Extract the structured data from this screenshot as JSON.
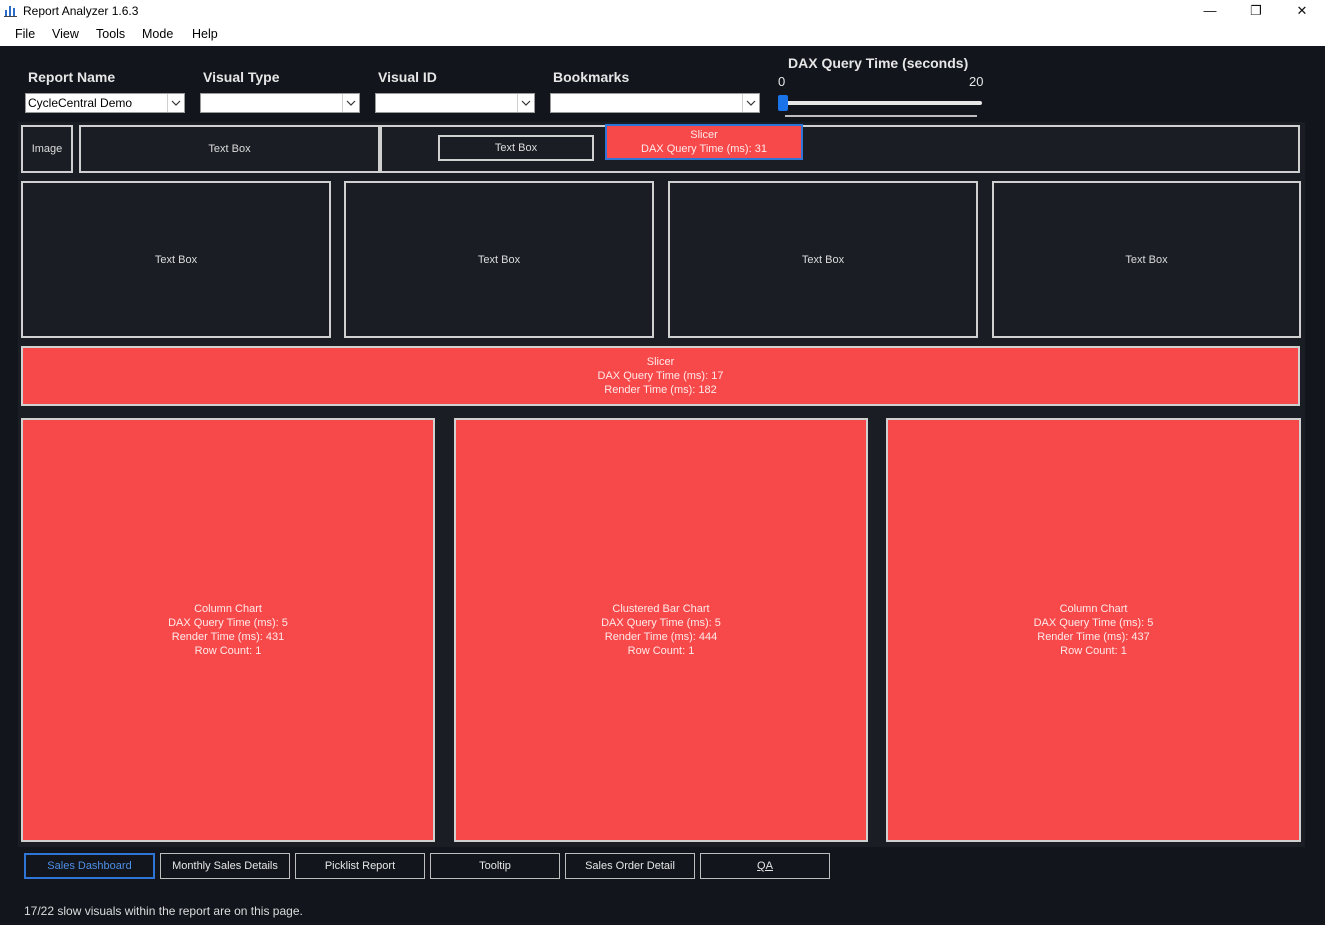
{
  "window": {
    "title": "Report Analyzer 1.6.3",
    "minimize_glyph": "—",
    "maximize_glyph": "❐",
    "close_glyph": "✕"
  },
  "menu": {
    "items": [
      "File",
      "View",
      "Tools",
      "Mode",
      "Help"
    ]
  },
  "filters": {
    "report_name": {
      "label": "Report Name",
      "value": "CycleCentral Demo"
    },
    "visual_type": {
      "label": "Visual Type",
      "value": ""
    },
    "visual_id": {
      "label": "Visual ID",
      "value": ""
    },
    "bookmarks": {
      "label": "Bookmarks",
      "value": ""
    }
  },
  "dax_slider": {
    "label": "DAX Query Time (seconds)",
    "min": "0",
    "max": "20",
    "value": 0
  },
  "visuals": {
    "image": {
      "type": "Image"
    },
    "textbox_top_1": {
      "type": "Text Box"
    },
    "textbox_top_2": {
      "type": "Text Box"
    },
    "slicer_top": {
      "type": "Slicer",
      "dax": "DAX Query Time (ms): 31"
    },
    "textbox_row_1": {
      "type": "Text Box"
    },
    "textbox_row_2": {
      "type": "Text Box"
    },
    "textbox_row_3": {
      "type": "Text Box"
    },
    "textbox_row_4": {
      "type": "Text Box"
    },
    "slicer_wide": {
      "type": "Slicer",
      "dax": "DAX Query Time (ms): 17",
      "render": "Render Time (ms): 182"
    },
    "column_chart_1": {
      "type": "Column Chart",
      "dax": "DAX Query Time (ms): 5",
      "render": "Render Time (ms): 431",
      "rows": "Row Count: 1"
    },
    "clustered_bar_chart": {
      "type": "Clustered Bar Chart",
      "dax": "DAX Query Time (ms): 5",
      "render": "Render Time (ms): 444",
      "rows": "Row Count: 1"
    },
    "column_chart_2": {
      "type": "Column Chart",
      "dax": "DAX Query Time (ms): 5",
      "render": "Render Time (ms): 437",
      "rows": "Row Count: 1"
    }
  },
  "tabs": [
    "Sales Dashboard",
    "Monthly Sales Details",
    "Picklist Report",
    "Tooltip",
    "Sales Order Detail",
    "QA"
  ],
  "status": "17/22 slow visuals within the report are on this page.",
  "colors": {
    "slow_visual": "#f7494a",
    "selected_accent": "#2f75d6",
    "background": "#12161c"
  }
}
